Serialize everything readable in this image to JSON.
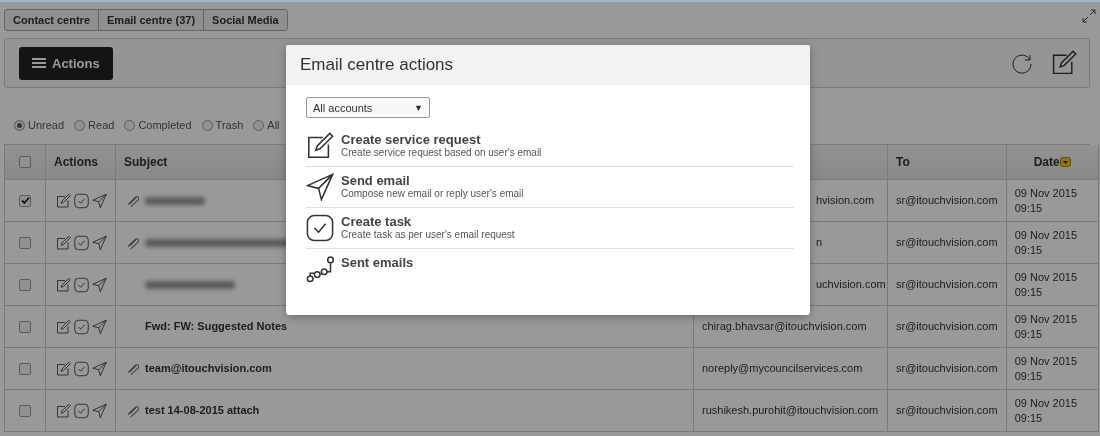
{
  "tabs": [
    {
      "label": "Contact centre"
    },
    {
      "label": "Email centre (37)"
    },
    {
      "label": "Social Media"
    }
  ],
  "toolbar": {
    "actions_button": "Actions"
  },
  "filters": [
    {
      "label": "Unread",
      "selected": true
    },
    {
      "label": "Read",
      "selected": false
    },
    {
      "label": "Completed",
      "selected": false
    },
    {
      "label": "Trash",
      "selected": false
    },
    {
      "label": "All",
      "selected": false
    }
  ],
  "table": {
    "header": {
      "select_all_checked": false,
      "actions": "Actions",
      "subject": "Subject",
      "to": "To",
      "date": "Date"
    },
    "rows": [
      {
        "checked": true,
        "attachment": true,
        "from": "hvision.com",
        "from_clipped": true,
        "to": "sr@itouchvision.com",
        "date": "09 Nov 2015 09:15"
      },
      {
        "checked": false,
        "attachment": true,
        "from": "n",
        "from_clipped": true,
        "to": "sr@itouchvision.com",
        "date": "09 Nov 2015 09:15"
      },
      {
        "checked": false,
        "attachment": false,
        "from": "uchvision.com",
        "from_clipped": true,
        "to": "sr@itouchvision.com",
        "date": "09 Nov 2015 09:15"
      },
      {
        "checked": false,
        "attachment": false,
        "subject": "Fwd: FW: Suggested Notes",
        "from": "chirag.bhavsar@itouchvision.com",
        "to": "sr@itouchvision.com",
        "date": "09 Nov 2015 09:15"
      },
      {
        "checked": false,
        "attachment": true,
        "subject": "team@itouchvision.com",
        "from": "noreply@mycouncilservices.com",
        "to": "sr@itouchvision.com",
        "date": "09 Nov 2015 09:15"
      },
      {
        "checked": false,
        "attachment": true,
        "subject": "test 14-08-2015 attach",
        "from": "rushikesh.purohit@itouchvision.com",
        "to": "sr@itouchvision.com",
        "date": "09 Nov 2015 09:15"
      }
    ]
  },
  "modal": {
    "title": "Email centre actions",
    "account_select": "All accounts",
    "account_caret": "▼",
    "items": [
      {
        "kind": "service_request",
        "title": "Create service request",
        "description": "Create service request based on user's email"
      },
      {
        "kind": "send",
        "title": "Send email",
        "description": "Compose new email or reply user's email"
      },
      {
        "kind": "task",
        "title": "Create task",
        "description": "Create task as per user's email request"
      },
      {
        "kind": "sent",
        "title": "Sent emails"
      }
    ]
  }
}
